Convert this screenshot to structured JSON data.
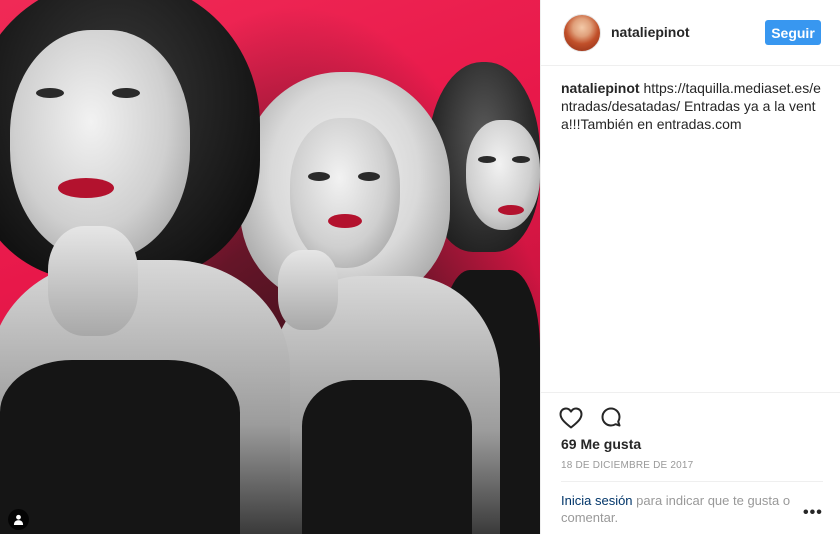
{
  "post": {
    "username": "nataliepinot",
    "follow_label": "Seguir",
    "caption_user": "nataliepinot",
    "caption_text": "https://taquilla.mediaset.es/entradas/desatadas/ Entradas ya a la venta!!!También en entradas.com",
    "likes": "69 Me gusta",
    "date": "18 DE DICIEMBRE DE 2017",
    "login_link": "Inicia sesión",
    "login_rest": " para indicar que te gusta o comentar.",
    "more_dots": "•••"
  },
  "icons": {
    "like": "heart-icon",
    "comment": "comment-icon",
    "tagged_user": "user-icon",
    "more": "more-options-icon"
  },
  "colors": {
    "follow_button": "#3897f0",
    "link": "#003569",
    "muted_text": "#999999",
    "photo_background": "#e8184a"
  }
}
